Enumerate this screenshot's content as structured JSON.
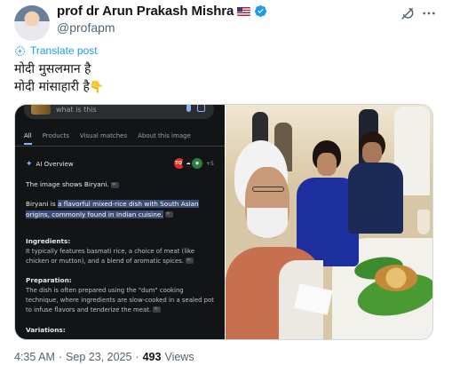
{
  "author": {
    "name": "prof dr Arun Prakash Mishra",
    "flag": "🇺🇸",
    "handle": "@profapm",
    "verified_color": "#1d9bf0"
  },
  "actions": {
    "grok_icon": "grok-icon",
    "more_icon": "more-icon"
  },
  "translate": {
    "label": "Translate post"
  },
  "post": {
    "line1": "मोदी मुसलमान है",
    "line2": "मोदी मांसाहारी है",
    "line2_emoji": "👇"
  },
  "screenshot": {
    "search_query": "what is this",
    "tabs": [
      "All",
      "Products",
      "Visual matches",
      "About this image"
    ],
    "ai_overview_label": "AI Overview",
    "sources_more": "+5",
    "answer_intro": "The image shows Biryani.",
    "def_prefix": "Biryani is ",
    "def_highlight": "a flavorful mixed-rice dish with South Asian origins, commonly found in Indian cuisine",
    "def_suffix": ".",
    "ingredients_head": "Ingredients:",
    "ingredients_body": "It typically features basmati rice, a choice of meat (like chicken or mutton), and a blend of aromatic spices.",
    "prep_head": "Preparation:",
    "prep_body": "The dish is often prepared using the \"dum\" cooking technique, where ingredients are slow-cooked in a sealed pot to infuse flavors and tenderize the meat.",
    "variations_head": "Variations:"
  },
  "meta": {
    "time": "4:35 AM",
    "sep1": "·",
    "date": "Sep 23, 2025",
    "sep2": "·",
    "views_count": "493",
    "views_label": "Views"
  },
  "colors": {
    "link": "#1d9bf0",
    "text": "#0f1419",
    "muted": "#536471",
    "google_dark": "#131416",
    "highlight": "#3b4d74"
  }
}
